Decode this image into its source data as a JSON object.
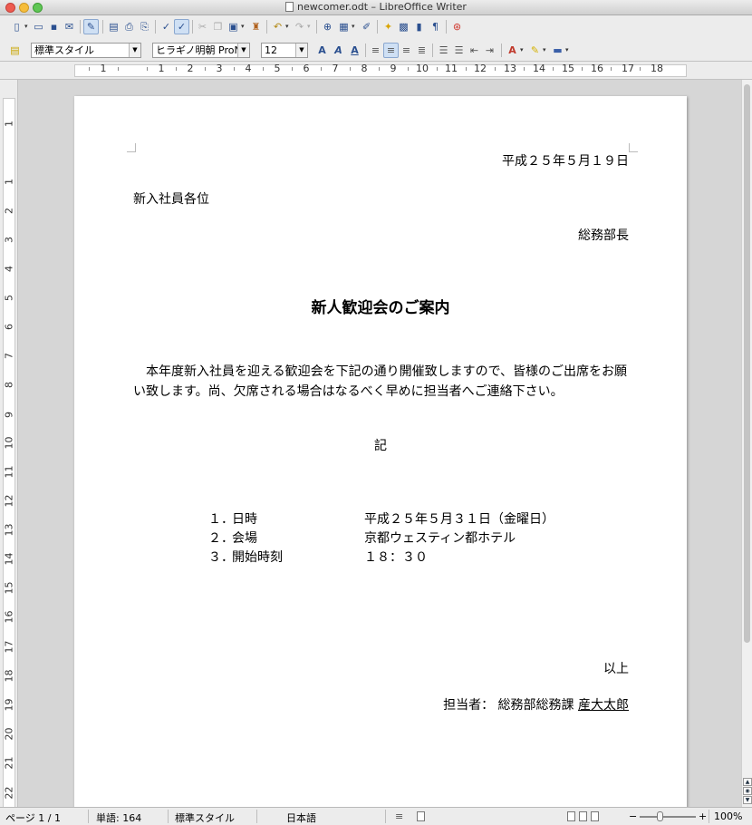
{
  "window": {
    "title": "newcomer.odt – LibreOffice Writer"
  },
  "formatting_toolbar": {
    "paragraph_style": "標準スタイル",
    "font_name": "ヒラギノ明朝 ProN W",
    "font_size": "12"
  },
  "ruler": {
    "horizontal": [
      "1",
      "1",
      "2",
      "3",
      "4",
      "5",
      "6",
      "7",
      "8",
      "9",
      "10",
      "11",
      "12",
      "13",
      "14",
      "15",
      "16",
      "17",
      "18"
    ],
    "vertical": [
      "1",
      "1",
      "2",
      "3",
      "4",
      "5",
      "6",
      "7",
      "8",
      "9",
      "10",
      "11",
      "12",
      "13",
      "14",
      "15",
      "16",
      "17",
      "18",
      "19",
      "20",
      "21",
      "22"
    ]
  },
  "document": {
    "date": "平成２５年５月１９日",
    "addressee": "新入社員各位",
    "sender": "総務部長",
    "title": "新人歓迎会のご案内",
    "body": "本年度新入社員を迎える歓迎会を下記の通り開催致しますので、皆様のご出席をお願い致します。尚、欠席される場合はなるべく早めに担当者へご連絡下さい。",
    "ki": "記",
    "items": [
      {
        "num": "１．",
        "label": "日時",
        "value": "平成２５年５月３１日（金曜日）"
      },
      {
        "num": "２．",
        "label": "会場",
        "value": "京都ウェスティン都ホテル"
      },
      {
        "num": "３．",
        "label": "開始時刻",
        "value": "１８：３０"
      }
    ],
    "closing": "以上",
    "contact_label": "担当者：",
    "contact_dept": "総務部総務課",
    "contact_name": "産大太郎"
  },
  "statusbar": {
    "page": "ページ 1 / 1",
    "words": "単語: 164",
    "style": "標準スタイル",
    "language": "日本語",
    "zoom": "100%"
  }
}
